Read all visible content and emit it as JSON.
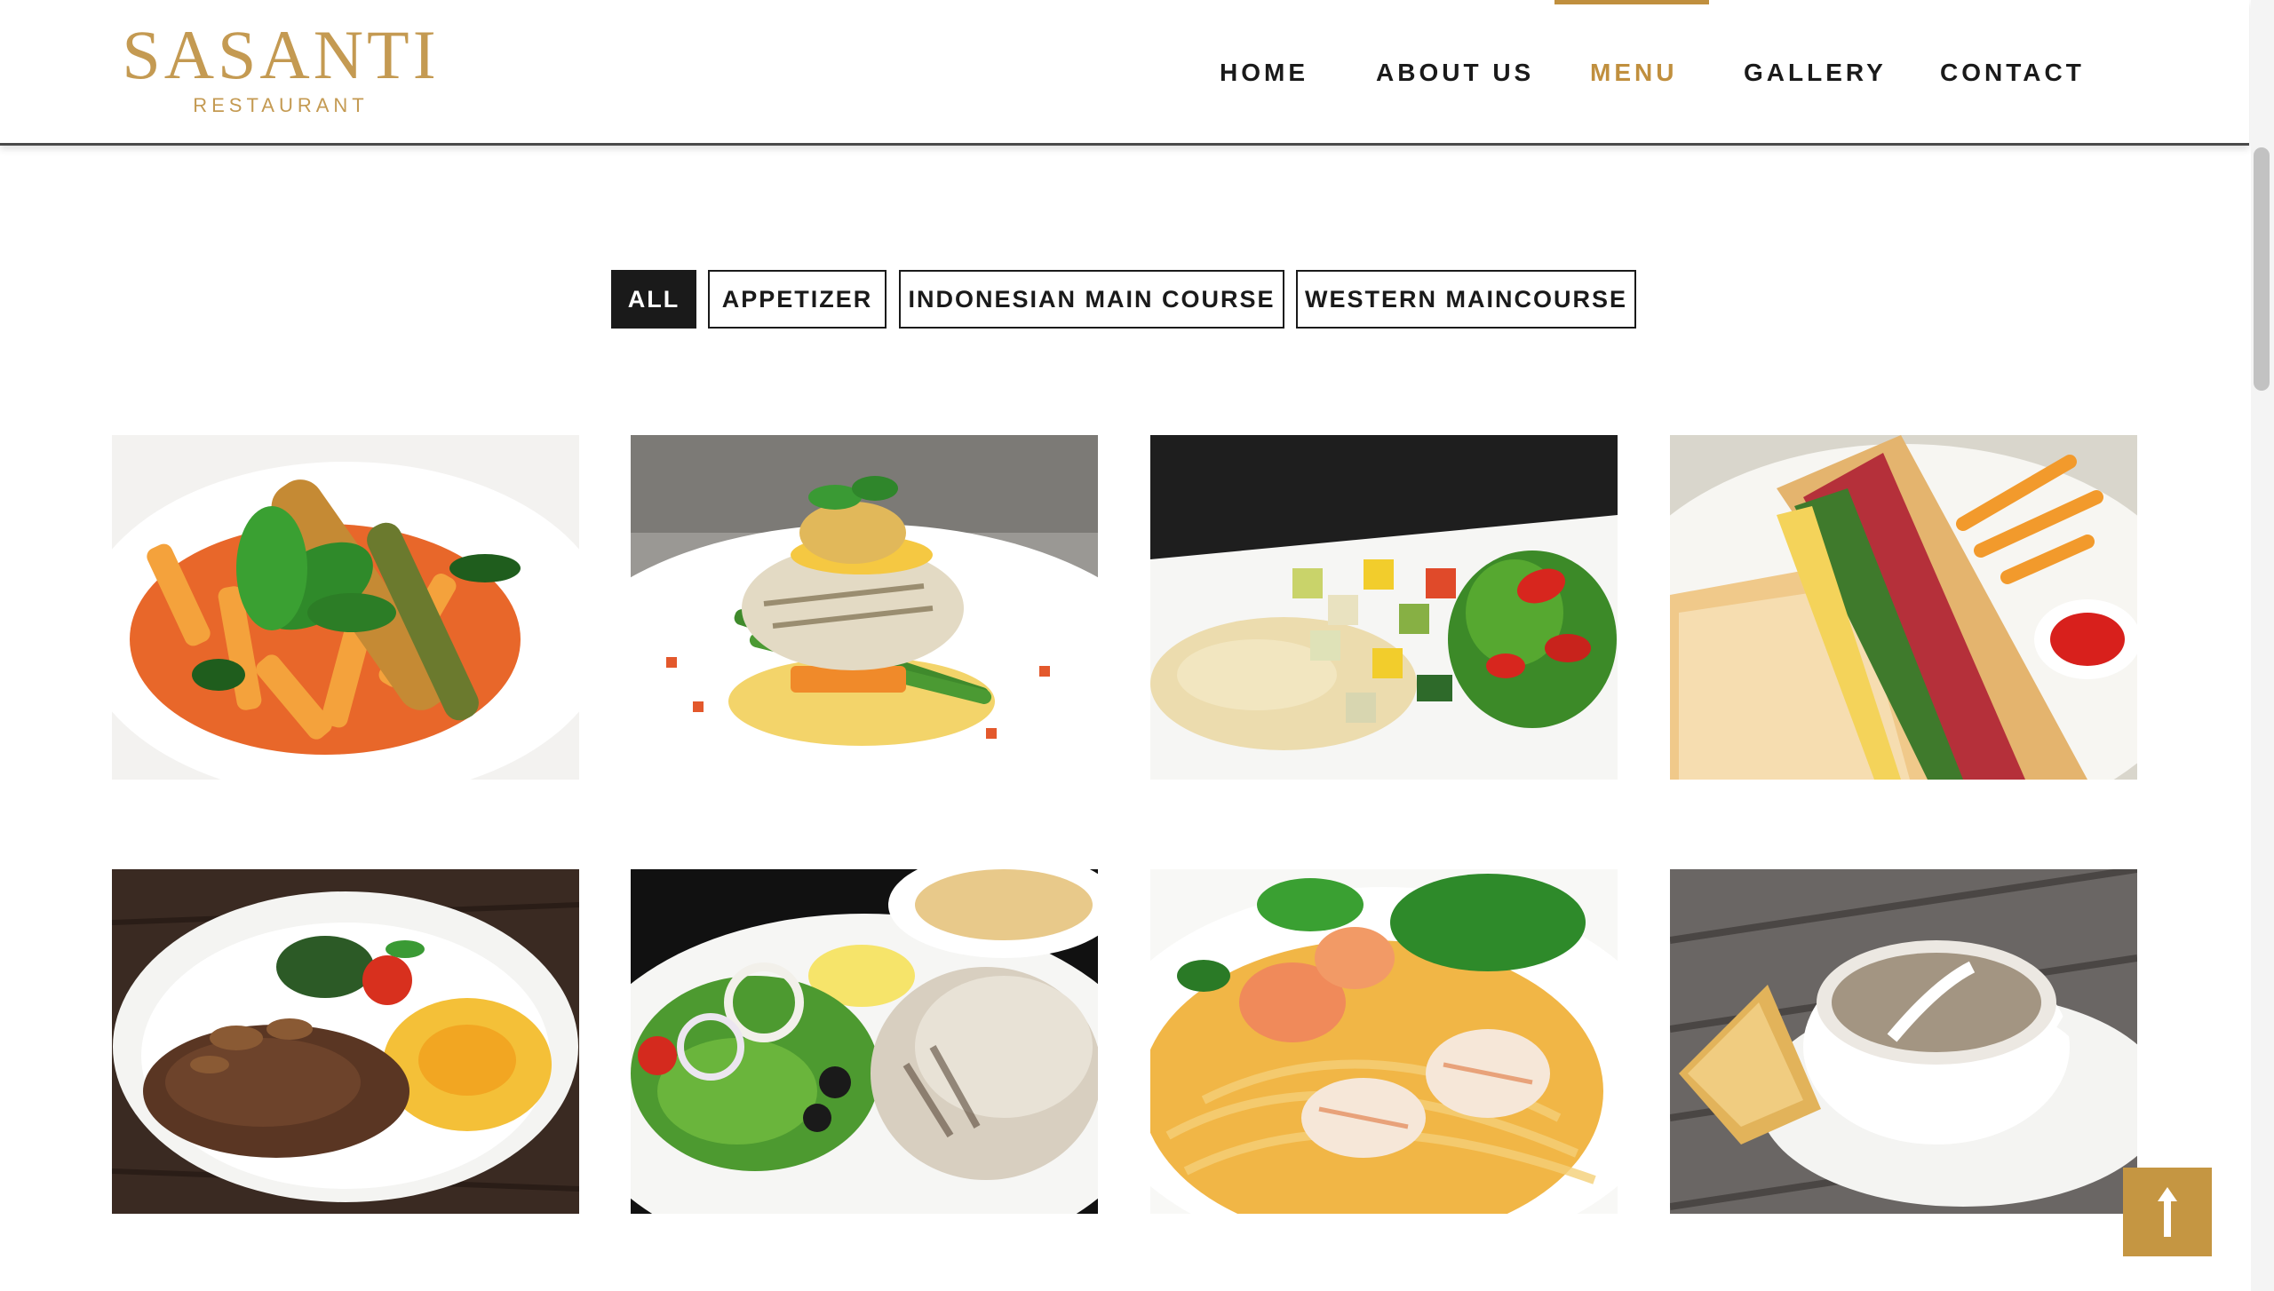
{
  "brand": {
    "name": "SASANTI",
    "tagline": "RESTAURANT",
    "color": "#c49a52"
  },
  "nav": {
    "items": [
      {
        "label": "HOME",
        "active": false
      },
      {
        "label": "ABOUT US",
        "active": false
      },
      {
        "label": "MENU",
        "active": true
      },
      {
        "label": "GALLERY",
        "active": false
      },
      {
        "label": "CONTACT",
        "active": false
      }
    ],
    "accent_color": "#c08f3e"
  },
  "filters": {
    "items": [
      {
        "label": "ALL",
        "active": true
      },
      {
        "label": "APPETIZER",
        "active": false
      },
      {
        "label": "INDONESIAN MAIN COURSE",
        "active": false
      },
      {
        "label": "WESTERN MAINCOURSE",
        "active": false
      }
    ]
  },
  "gallery": {
    "items": [
      {
        "icon": "penne-pasta-dish-image"
      },
      {
        "icon": "grilled-fish-dish-image"
      },
      {
        "icon": "fish-with-vegetables-dish-image"
      },
      {
        "icon": "sandwich-with-fries-dish-image"
      },
      {
        "icon": "steak-with-egg-dish-image"
      },
      {
        "icon": "chicken-with-salad-dish-image"
      },
      {
        "icon": "seafood-pasta-dish-image"
      },
      {
        "icon": "soup-with-bread-dish-image"
      }
    ]
  },
  "back_to_top": {
    "icon": "arrow-up-icon",
    "color": "#c59642"
  }
}
